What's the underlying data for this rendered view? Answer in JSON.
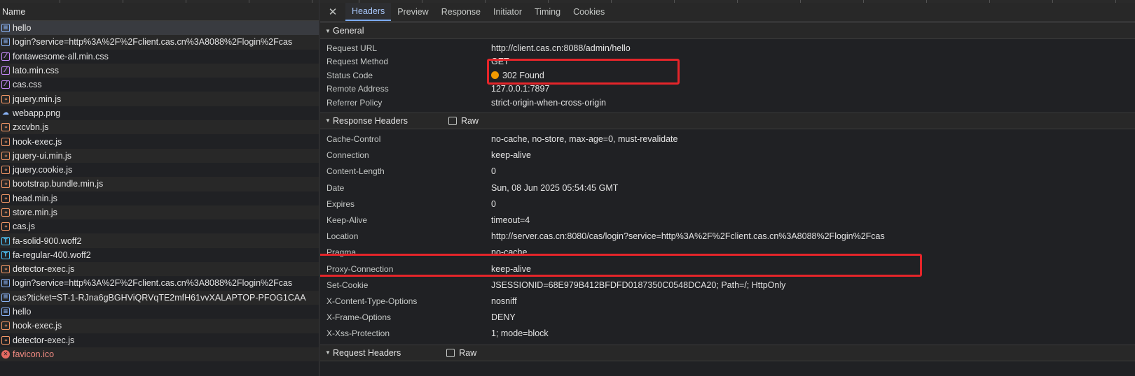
{
  "list": {
    "header": "Name",
    "requests": [
      {
        "name": "hello",
        "type": "doc",
        "icon": "document-icon",
        "selected": true,
        "error": false
      },
      {
        "name": "login?service=http%3A%2F%2Fclient.cas.cn%3A8088%2Flogin%2Fcas",
        "type": "doc",
        "icon": "document-icon",
        "selected": false,
        "error": false
      },
      {
        "name": "fontawesome-all.min.css",
        "type": "css",
        "icon": "stylesheet-icon",
        "selected": false,
        "error": false
      },
      {
        "name": "lato.min.css",
        "type": "css",
        "icon": "stylesheet-icon",
        "selected": false,
        "error": false
      },
      {
        "name": "cas.css",
        "type": "css",
        "icon": "stylesheet-icon",
        "selected": false,
        "error": false
      },
      {
        "name": "jquery.min.js",
        "type": "js",
        "icon": "script-icon",
        "selected": false,
        "error": false
      },
      {
        "name": "webapp.png",
        "type": "img",
        "icon": "image-icon",
        "selected": false,
        "error": false
      },
      {
        "name": "zxcvbn.js",
        "type": "js",
        "icon": "script-icon",
        "selected": false,
        "error": false
      },
      {
        "name": "hook-exec.js",
        "type": "js",
        "icon": "script-icon",
        "selected": false,
        "error": false
      },
      {
        "name": "jquery-ui.min.js",
        "type": "js",
        "icon": "script-icon",
        "selected": false,
        "error": false
      },
      {
        "name": "jquery.cookie.js",
        "type": "js",
        "icon": "script-icon",
        "selected": false,
        "error": false
      },
      {
        "name": "bootstrap.bundle.min.js",
        "type": "js",
        "icon": "script-icon",
        "selected": false,
        "error": false
      },
      {
        "name": "head.min.js",
        "type": "js",
        "icon": "script-icon",
        "selected": false,
        "error": false
      },
      {
        "name": "store.min.js",
        "type": "js",
        "icon": "script-icon",
        "selected": false,
        "error": false
      },
      {
        "name": "cas.js",
        "type": "js",
        "icon": "script-icon",
        "selected": false,
        "error": false
      },
      {
        "name": "fa-solid-900.woff2",
        "type": "font",
        "icon": "font-icon",
        "selected": false,
        "error": false
      },
      {
        "name": "fa-regular-400.woff2",
        "type": "font",
        "icon": "font-icon",
        "selected": false,
        "error": false
      },
      {
        "name": "detector-exec.js",
        "type": "js",
        "icon": "script-icon",
        "selected": false,
        "error": false
      },
      {
        "name": "login?service=http%3A%2F%2Fclient.cas.cn%3A8088%2Flogin%2Fcas",
        "type": "doc",
        "icon": "document-icon",
        "selected": false,
        "error": false
      },
      {
        "name": "cas?ticket=ST-1-RJna6gBGHViQRVqTE2mfH61vvXALAPTOP-PFOG1CAA",
        "type": "doc",
        "icon": "document-icon",
        "selected": false,
        "error": false
      },
      {
        "name": "hello",
        "type": "doc",
        "icon": "document-icon",
        "selected": false,
        "error": false
      },
      {
        "name": "hook-exec.js",
        "type": "js",
        "icon": "script-icon",
        "selected": false,
        "error": false
      },
      {
        "name": "detector-exec.js",
        "type": "js",
        "icon": "script-icon",
        "selected": false,
        "error": false
      },
      {
        "name": "favicon.ico",
        "type": "err",
        "icon": "error-icon",
        "selected": false,
        "error": true
      }
    ]
  },
  "tabs": {
    "close_icon": "close-icon",
    "items": [
      "Headers",
      "Preview",
      "Response",
      "Initiator",
      "Timing",
      "Cookies"
    ],
    "active": "Headers"
  },
  "general": {
    "title": "General",
    "rows": [
      {
        "key": "Request URL",
        "value": "http://client.cas.cn:8088/admin/hello"
      },
      {
        "key": "Request Method",
        "value": "GET"
      },
      {
        "key": "Status Code",
        "value": "302 Found",
        "status_color": "#f29900"
      },
      {
        "key": "Remote Address",
        "value": "127.0.0.1:7897"
      },
      {
        "key": "Referrer Policy",
        "value": "strict-origin-when-cross-origin"
      }
    ]
  },
  "response_headers": {
    "title": "Response Headers",
    "raw_label": "Raw",
    "rows": [
      {
        "key": "Cache-Control",
        "value": "no-cache, no-store, max-age=0, must-revalidate"
      },
      {
        "key": "Connection",
        "value": "keep-alive"
      },
      {
        "key": "Content-Length",
        "value": "0"
      },
      {
        "key": "Date",
        "value": "Sun, 08 Jun 2025 05:54:45 GMT"
      },
      {
        "key": "Expires",
        "value": "0"
      },
      {
        "key": "Keep-Alive",
        "value": "timeout=4"
      },
      {
        "key": "Location",
        "value": "http://server.cas.cn:8080/cas/login?service=http%3A%2F%2Fclient.cas.cn%3A8088%2Flogin%2Fcas"
      },
      {
        "key": "Pragma",
        "value": "no-cache"
      },
      {
        "key": "Proxy-Connection",
        "value": "keep-alive"
      },
      {
        "key": "Set-Cookie",
        "value": "JSESSIONID=68E979B412BFDFD0187350C0548DCA20; Path=/; HttpOnly"
      },
      {
        "key": "X-Content-Type-Options",
        "value": "nosniff"
      },
      {
        "key": "X-Frame-Options",
        "value": "DENY"
      },
      {
        "key": "X-Xss-Protection",
        "value": "1; mode=block"
      }
    ]
  },
  "request_headers": {
    "title": "Request Headers",
    "raw_label": "Raw"
  },
  "colors": {
    "highlight": "#e5252a",
    "active_tab": "#a8c7fa",
    "error_text": "#f28b82"
  }
}
